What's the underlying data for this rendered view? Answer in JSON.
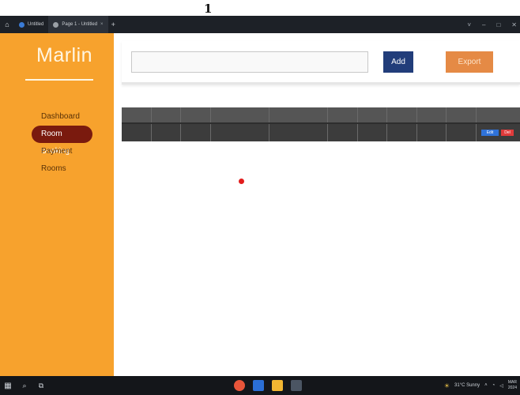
{
  "page_marker": "1",
  "browser": {
    "tabs": [
      {
        "label": "Untitled",
        "icon": "app-icon",
        "active": false
      },
      {
        "label": "Page 1 - Untitled",
        "icon": "page-icon",
        "active": true
      }
    ],
    "new_tab": "+",
    "window_controls": [
      "˅",
      "–",
      "□",
      "✕"
    ]
  },
  "sidebar": {
    "brand": "Marlin",
    "items": [
      {
        "label": "Dashboard",
        "active": false
      },
      {
        "label": "Room Booking",
        "active": true
      },
      {
        "label": "Payment",
        "active": false
      },
      {
        "label": "Rooms",
        "active": false
      }
    ]
  },
  "toolbar": {
    "search_value": "",
    "add_label": "Add",
    "export_label": "Export"
  },
  "table": {
    "row_actions": {
      "edit_label": "Edit",
      "delete_label": "Del"
    }
  },
  "taskbar": {
    "weather": "31°C Sunny",
    "clock_time": "MAR",
    "clock_date": "2024"
  },
  "colors": {
    "sidebar": "#f7a22d",
    "active_nav": "#7a1a0e",
    "add_button": "#213d7a",
    "export_button": "#e58a45",
    "table_header": "#555555"
  }
}
